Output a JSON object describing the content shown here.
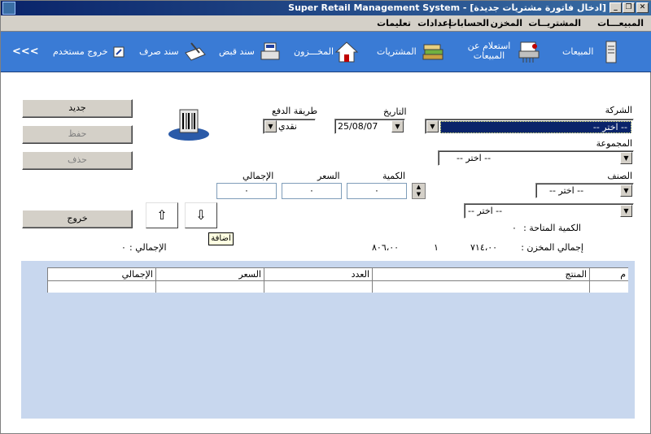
{
  "window": {
    "title": "Super Retail Management System - [ادخال فاتورة مشتريات جديدة]",
    "controls": [
      "_",
      "❐",
      "✕"
    ]
  },
  "menu": {
    "items": [
      "المبيعـــات",
      "المشتريــات",
      "المخزن",
      "الحسابات",
      "إعدادات",
      "تعليمات"
    ]
  },
  "toolbar": {
    "sales": "المبيعات",
    "sales_inquiry_line1": "استعلام عن",
    "sales_inquiry_line2": "المبيعات",
    "purchases": "المشتريات",
    "inventory": "المخـــزون",
    "receipt_voucher": "سند قبض",
    "payment_voucher": "سند صرف",
    "logout": "خروج مستخدم",
    "more": "<<<"
  },
  "form": {
    "company_label": "الشركة",
    "company_value": "-- اختر --",
    "group_label": "المجموعة",
    "group_value": "-- اختر --",
    "category_label": "الصنف",
    "category_value": "-- اختر --",
    "item_value": "-- اختر --",
    "date_label": "التاريخ",
    "date_value": "25/08/07",
    "payment_label": "طريقة الدفع",
    "payment_value": "نقدي",
    "qty_label": "الكمية",
    "qty_value": "٠",
    "price_label": "السعر",
    "price_value": "٠",
    "total_label": "الإجمالي",
    "total_value": "٠",
    "available_qty_label": "الكمية المتاحة :",
    "available_qty_value": "٠",
    "stock_total_label": "إجمالي المخزن :",
    "stock_total_value": "٧١٤،٠٠",
    "count_value": "١",
    "amount_value": "٨٠٦،٠٠",
    "grand_total_label": "الإجمالي :",
    "grand_total_value": "٠"
  },
  "buttons": {
    "new": "جديد",
    "save": "حفظ",
    "delete": "حذف",
    "exit": "خروج",
    "add_tooltip": "اضافة"
  },
  "grid": {
    "columns": [
      "م",
      "المنتج",
      "العدد",
      "السعر",
      "الإجمالي"
    ]
  },
  "colors": {
    "titlebar": "#0a246a",
    "toolbar": "#3a7bd5",
    "grid_panel": "#c8d7ee"
  }
}
